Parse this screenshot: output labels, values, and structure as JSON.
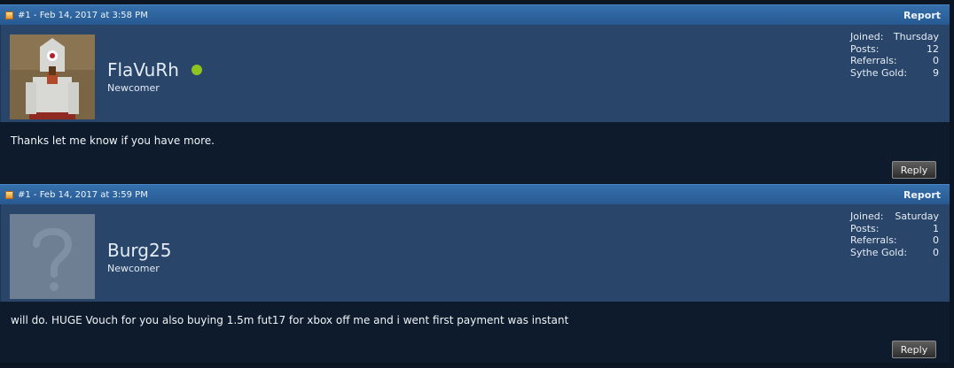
{
  "posts": [
    {
      "meta": "#1 - Feb 14, 2017 at 3:58 PM",
      "report_label": "Report",
      "username": "FlaVuRh",
      "online": true,
      "user_title": "Newcomer",
      "stats": [
        {
          "label": "Joined:",
          "value": "Thursday"
        },
        {
          "label": "Posts:",
          "value": "12"
        },
        {
          "label": "Referrals:",
          "value": "0"
        },
        {
          "label": "Sythe Gold:",
          "value": "9"
        }
      ],
      "message": "Thanks let me know if you have more.",
      "reply_label": "Reply"
    },
    {
      "meta": "#1 - Feb 14, 2017 at 3:59 PM",
      "report_label": "Report",
      "username": "Burg25",
      "online": false,
      "user_title": "Newcomer",
      "stats": [
        {
          "label": "Joined:",
          "value": "Saturday"
        },
        {
          "label": "Posts:",
          "value": "1"
        },
        {
          "label": "Referrals:",
          "value": "0"
        },
        {
          "label": "Sythe Gold:",
          "value": "0"
        }
      ],
      "message": "will do. HUGE Vouch for you also buying 1.5m fut17 for xbox off me and i went first payment was instant",
      "reply_label": "Reply"
    }
  ],
  "colors": {
    "header_blue": "#2e64a0",
    "user_panel": "#29456a",
    "body_dark": "#0d1b2c",
    "online_green": "#8fc31f"
  }
}
